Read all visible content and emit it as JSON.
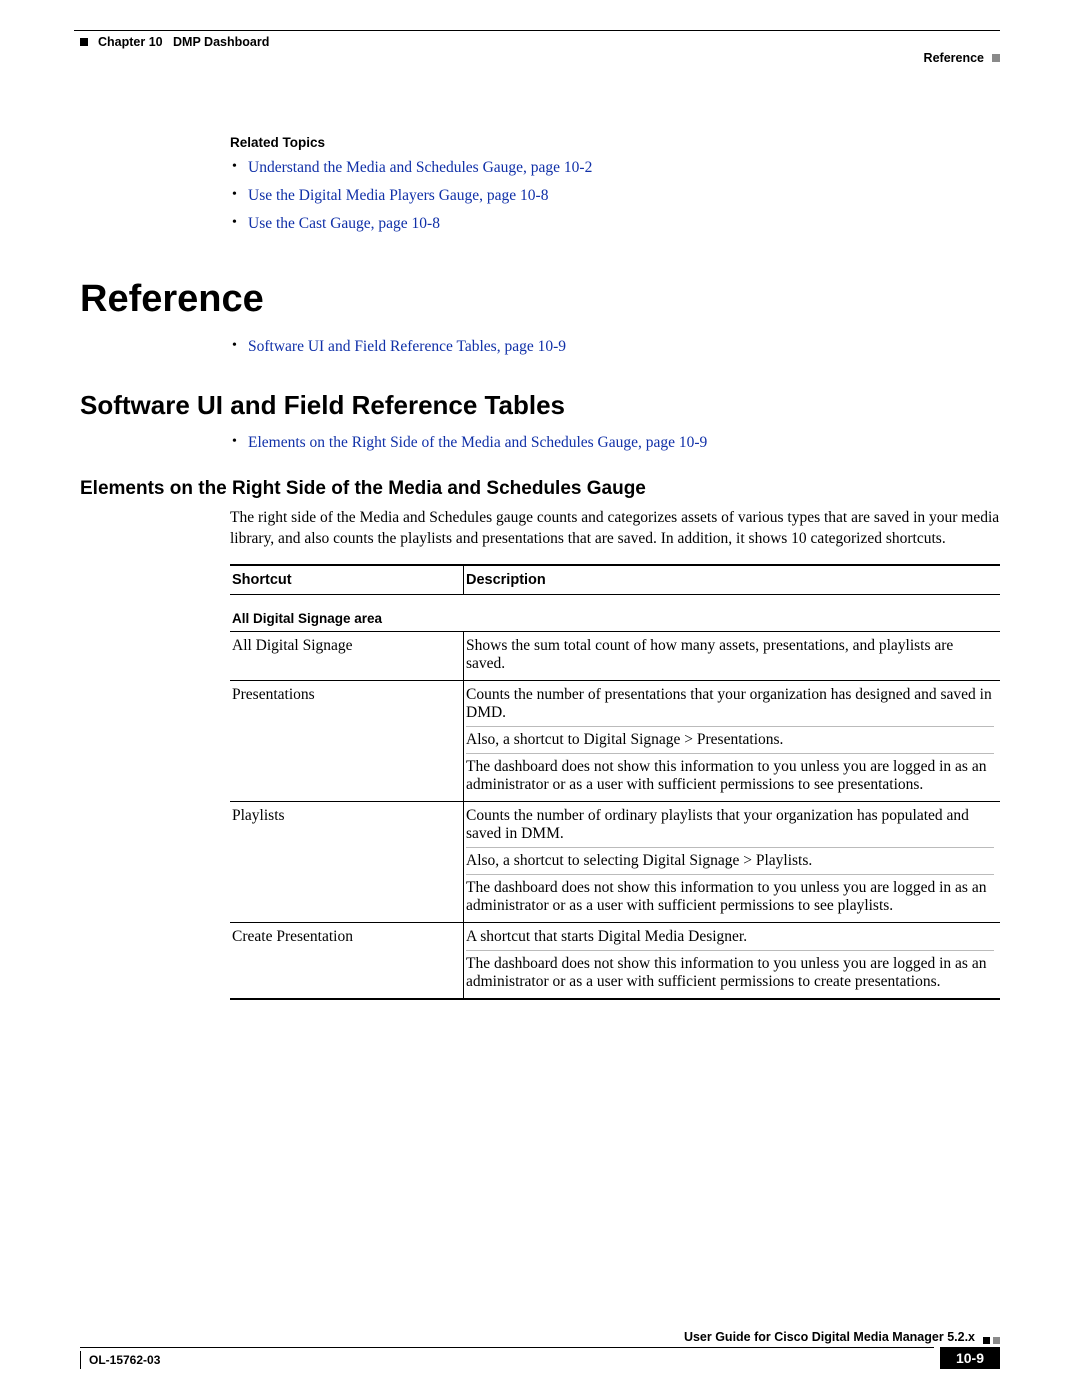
{
  "header": {
    "chapter_label": "Chapter 10",
    "chapter_title": "DMP Dashboard",
    "section": "Reference"
  },
  "related_topics": {
    "heading": "Related Topics",
    "items": [
      "Understand the Media and Schedules Gauge, page 10-2",
      "Use the Digital Media Players Gauge, page 10-8",
      "Use the Cast Gauge, page 10-8"
    ]
  },
  "h1": "Reference",
  "ref_list": {
    "items": [
      "Software UI and Field Reference Tables, page 10-9"
    ]
  },
  "h2": "Software UI and Field Reference Tables",
  "h2_list": {
    "items": [
      "Elements on the Right Side of the Media and Schedules Gauge, page 10-9"
    ]
  },
  "h3": "Elements on the Right Side of the Media and Schedules Gauge",
  "intro": "The right side of the Media and Schedules gauge counts and categorizes assets of various types that are saved in your media library, and also counts the playlists and presentations that are saved. In addition, it shows 10 categorized shortcuts.",
  "table": {
    "head": {
      "c1": "Shortcut",
      "c2": "Description"
    },
    "section": "All Digital Signage area",
    "rows": [
      {
        "c1": "All Digital Signage",
        "c2": [
          "Shows the sum total count of how many assets, presentations, and playlists are saved."
        ]
      },
      {
        "c1": "Presentations",
        "c2": [
          "Counts the number of presentations that your organization has designed and saved in DMD.",
          "Also, a shortcut to Digital Signage > Presentations.",
          "The dashboard does not show this information to you unless you are logged in as an administrator or as a user with sufficient permissions to see presentations."
        ]
      },
      {
        "c1": "Playlists",
        "c2": [
          "Counts the number of ordinary playlists that your organization has populated and saved in DMM.",
          "Also, a shortcut to selecting Digital Signage > Playlists.",
          "The dashboard does not show this information to you unless you are logged in as an administrator or as a user with sufficient permissions to see playlists."
        ]
      },
      {
        "c1": "Create Presentation",
        "c2": [
          "A shortcut that starts Digital Media Designer.",
          "The dashboard does not show this information to you unless you are logged in as an administrator or as a user with sufficient permissions to create presentations."
        ]
      }
    ]
  },
  "footer": {
    "guide": "User Guide for Cisco Digital Media Manager 5.2.x",
    "doc": "OL-15762-03",
    "page": "10-9"
  }
}
